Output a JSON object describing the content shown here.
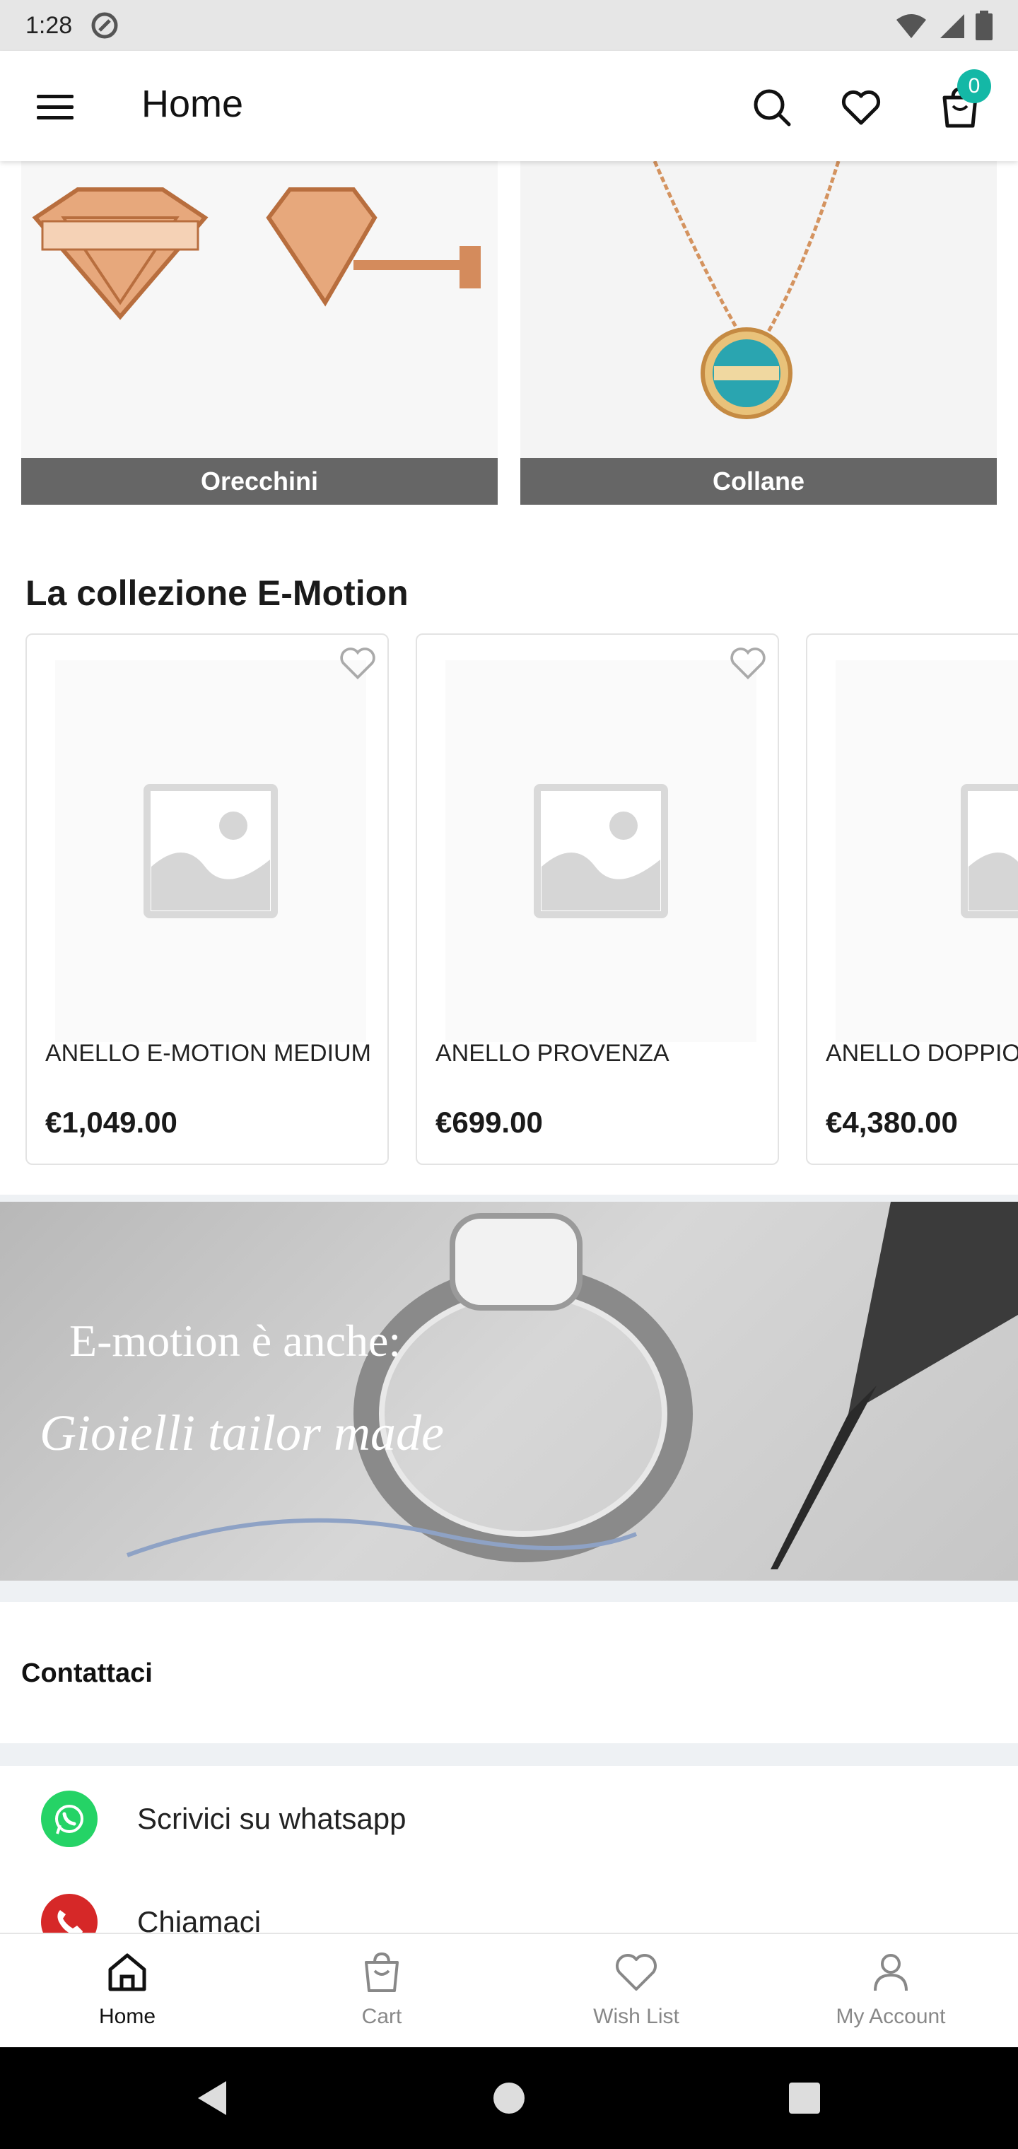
{
  "status_bar": {
    "time": "1:28"
  },
  "app_bar": {
    "title": "Home",
    "cart_count": "0"
  },
  "categories": [
    {
      "label": "Orecchini"
    },
    {
      "label": "Collane"
    }
  ],
  "collection": {
    "title": "La collezione E-Motion",
    "products": [
      {
        "name": "ANELLO E-MOTION MEDIUM",
        "price": "€1,049.00"
      },
      {
        "name": "ANELLO PROVENZA",
        "price": "€699.00"
      },
      {
        "name": "ANELLO DOPPIO DIAMANTI",
        "price": "€4,380.00"
      }
    ]
  },
  "banner": {
    "line1": "E-motion è anche:",
    "line2": "Gioielli tailor made"
  },
  "contact": {
    "heading": "Contattaci",
    "items": [
      {
        "label": "Scrivici su whatsapp",
        "icon": "whatsapp-icon",
        "color": "#25d366"
      },
      {
        "label": "Chiamaci",
        "icon": "phone-icon",
        "color": "#d62828"
      }
    ]
  },
  "bottom_nav": [
    {
      "label": "Home",
      "icon": "home-icon",
      "active": true
    },
    {
      "label": "Cart",
      "icon": "bag-icon",
      "active": false
    },
    {
      "label": "Wish List",
      "icon": "heart-icon",
      "active": false
    },
    {
      "label": "My Account",
      "icon": "person-icon",
      "active": false
    }
  ],
  "colors": {
    "accent": "#14b8a6",
    "category_label_bg": "#666666"
  }
}
